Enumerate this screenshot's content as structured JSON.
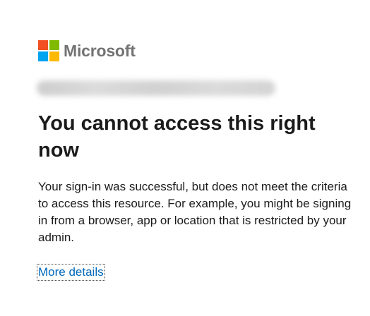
{
  "brand": {
    "name": "Microsoft",
    "colors": {
      "red": "#f25022",
      "green": "#7fba00",
      "blue": "#00a4ef",
      "yellow": "#ffb900"
    }
  },
  "account": {
    "email_redacted": true
  },
  "error": {
    "title": "You cannot access this right now",
    "message": "Your sign-in was successful, but does not meet the criteria to access this resource. For example, you might be signing in from a browser, app or location that is restricted by your admin."
  },
  "links": {
    "more_details": "More details"
  },
  "colors": {
    "link": "#0067b8",
    "text": "#1b1b1b",
    "logo_text": "#737373"
  }
}
